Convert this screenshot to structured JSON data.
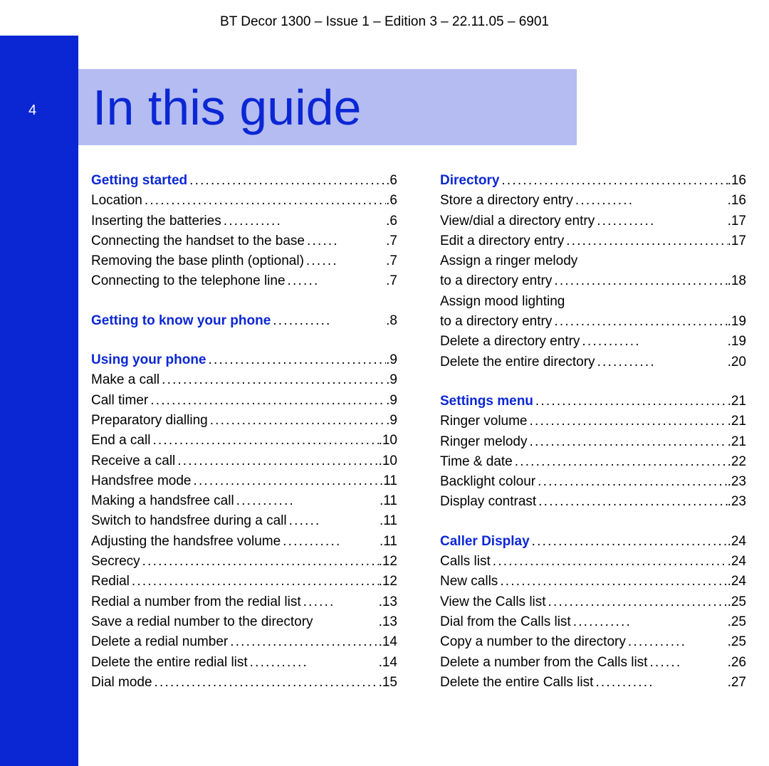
{
  "header": "BT Decor 1300 – Issue 1 – Edition 3 – 22.11.05 – 6901",
  "page_number": "4",
  "title": "In this guide",
  "left_column": [
    {
      "type": "heading",
      "label": "Getting started",
      "page": "6"
    },
    {
      "type": "item",
      "label": "Location",
      "page": "6"
    },
    {
      "type": "item",
      "label": "Inserting the batteries",
      "page": "6"
    },
    {
      "type": "item",
      "label": "Connecting the handset to the base",
      "page": "7"
    },
    {
      "type": "item",
      "label": "Removing the base plinth (optional)",
      "page": "7"
    },
    {
      "type": "item",
      "label": "Connecting to the telephone line",
      "page": "7"
    },
    {
      "type": "gap"
    },
    {
      "type": "heading",
      "label": "Getting to know your phone",
      "page": "8"
    },
    {
      "type": "gap"
    },
    {
      "type": "heading",
      "label": "Using your phone",
      "page": "9"
    },
    {
      "type": "item",
      "label": "Make a call",
      "page": "9"
    },
    {
      "type": "item",
      "label": "Call timer",
      "page": "9"
    },
    {
      "type": "item",
      "label": "Preparatory dialling",
      "page": "9"
    },
    {
      "type": "item",
      "label": "End a call",
      "page": "10"
    },
    {
      "type": "item",
      "label": "Receive a call",
      "page": "10"
    },
    {
      "type": "item",
      "label": "Handsfree mode",
      "page": "11"
    },
    {
      "type": "item",
      "label": "Making a handsfree call",
      "page": "11"
    },
    {
      "type": "item",
      "label": "Switch to handsfree during a call",
      "page": "11"
    },
    {
      "type": "item",
      "label": "Adjusting the handsfree volume",
      "page": "11"
    },
    {
      "type": "item",
      "label": "Secrecy",
      "page": "12"
    },
    {
      "type": "item",
      "label": "Redial",
      "page": "12"
    },
    {
      "type": "item",
      "label": "Redial a number from the redial list",
      "page": "13"
    },
    {
      "type": "item",
      "label": "Save a redial number to the directory",
      "page": "13",
      "nodots": true
    },
    {
      "type": "item",
      "label": "Delete a redial number",
      "page": "14"
    },
    {
      "type": "item",
      "label": "Delete the entire redial list",
      "page": "14"
    },
    {
      "type": "item",
      "label": "Dial mode",
      "page": "15"
    }
  ],
  "right_column": [
    {
      "type": "heading",
      "label": "Directory",
      "page": "16"
    },
    {
      "type": "item",
      "label": "Store a directory entry",
      "page": "16"
    },
    {
      "type": "item",
      "label": "View/dial a directory entry",
      "page": "17"
    },
    {
      "type": "item",
      "label": "Edit a directory entry",
      "page": "17"
    },
    {
      "type": "wrap",
      "line1": "Assign a ringer melody",
      "line2": "to a directory entry",
      "page": "18"
    },
    {
      "type": "wrap",
      "line1": "Assign mood lighting",
      "line2": "to a directory entry",
      "page": "19"
    },
    {
      "type": "item",
      "label": "Delete a directory entry",
      "page": "19"
    },
    {
      "type": "item",
      "label": "Delete the entire directory",
      "page": "20"
    },
    {
      "type": "gap"
    },
    {
      "type": "heading",
      "label": "Settings menu",
      "page": "21"
    },
    {
      "type": "item",
      "label": "Ringer volume",
      "page": "21"
    },
    {
      "type": "item",
      "label": "Ringer melody",
      "page": "21"
    },
    {
      "type": "item",
      "label": "Time & date",
      "page": "22"
    },
    {
      "type": "item",
      "label": "Backlight colour",
      "page": "23"
    },
    {
      "type": "item",
      "label": "Display contrast",
      "page": "23"
    },
    {
      "type": "gap"
    },
    {
      "type": "heading",
      "label": "Caller Display",
      "page": "24"
    },
    {
      "type": "item",
      "label": "Calls list",
      "page": "24"
    },
    {
      "type": "item",
      "label": "New calls",
      "page": "24"
    },
    {
      "type": "item",
      "label": "View the Calls list",
      "page": "25"
    },
    {
      "type": "item",
      "label": "Dial from the Calls list",
      "page": "25"
    },
    {
      "type": "item",
      "label": "Copy a number to the directory",
      "page": "25"
    },
    {
      "type": "item",
      "label": "Delete a number from the Calls list",
      "page": "26"
    },
    {
      "type": "item",
      "label": "Delete the entire Calls list",
      "page": "27"
    }
  ]
}
